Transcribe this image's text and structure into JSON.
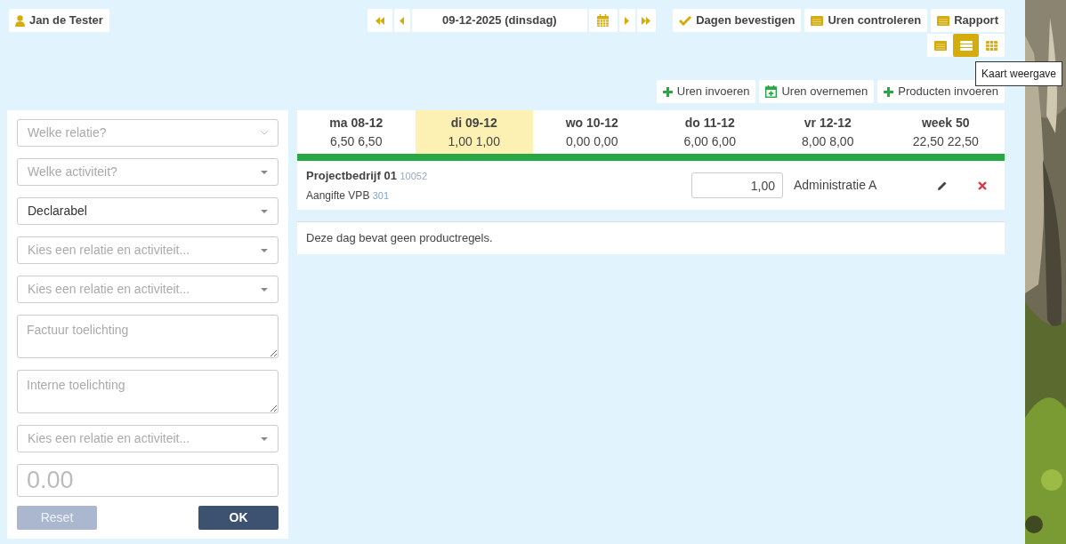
{
  "user": {
    "name": "Jan de Tester"
  },
  "date_nav": {
    "date": "09-12-2025 (dinsdag)"
  },
  "header_buttons": [
    {
      "label": "Dagen bevestigen",
      "kind": "check"
    },
    {
      "label": "Uren controleren",
      "kind": "card"
    },
    {
      "label": "Rapport",
      "kind": "card"
    }
  ],
  "view_toggle": [
    {
      "kind": "card",
      "selected": false
    },
    {
      "kind": "list",
      "selected": true
    },
    {
      "kind": "grid",
      "selected": false
    }
  ],
  "tooltip": "Kaart weergave",
  "action_buttons": [
    {
      "label": "Uren invoeren",
      "kind": "plus"
    },
    {
      "label": "Uren overnemen",
      "kind": "calendar-plus"
    },
    {
      "label": "Producten invoeren",
      "kind": "plus"
    }
  ],
  "form": {
    "fields": [
      {
        "kind": "search-select",
        "placeholder": "Welke relatie?"
      },
      {
        "kind": "select",
        "placeholder": "Welke activiteit?"
      },
      {
        "kind": "select",
        "value": "Declarabel"
      },
      {
        "kind": "select",
        "placeholder": "Kies een relatie en activiteit..."
      },
      {
        "kind": "select",
        "placeholder": "Kies een relatie en activiteit..."
      },
      {
        "kind": "textarea",
        "placeholder": "Factuur toelichting"
      },
      {
        "kind": "textarea",
        "placeholder": "Interne toelichting"
      },
      {
        "kind": "select",
        "placeholder": "Kies een relatie en activiteit..."
      },
      {
        "kind": "amount",
        "placeholder": "0.00"
      }
    ],
    "buttons": [
      {
        "label": "Reset",
        "kind": "reset",
        "disabled": true
      },
      {
        "label": "OK",
        "kind": "submit",
        "disabled": false
      }
    ]
  },
  "days": [
    {
      "label": "ma 08-12",
      "hours": "6,50 6,50",
      "selected": false
    },
    {
      "label": "di 09-12",
      "hours": "1,00 1,00",
      "selected": true
    },
    {
      "label": "wo 10-12",
      "hours": "0,00 0,00",
      "selected": false
    },
    {
      "label": "do 11-12",
      "hours": "6,00 6,00",
      "selected": false
    },
    {
      "label": "vr 12-12",
      "hours": "8,00 8,00",
      "selected": false
    },
    {
      "label": "week 50",
      "hours": "22,50 22,50",
      "selected": false
    }
  ],
  "entries": [
    {
      "project": "Projectbedrijf 01",
      "project_code": "10052",
      "task": "Aangifte VPB",
      "task_code": "301",
      "hours": "1,00",
      "activity": "Administratie A"
    }
  ],
  "products_message": "Deze dag bevat geen productregels."
}
